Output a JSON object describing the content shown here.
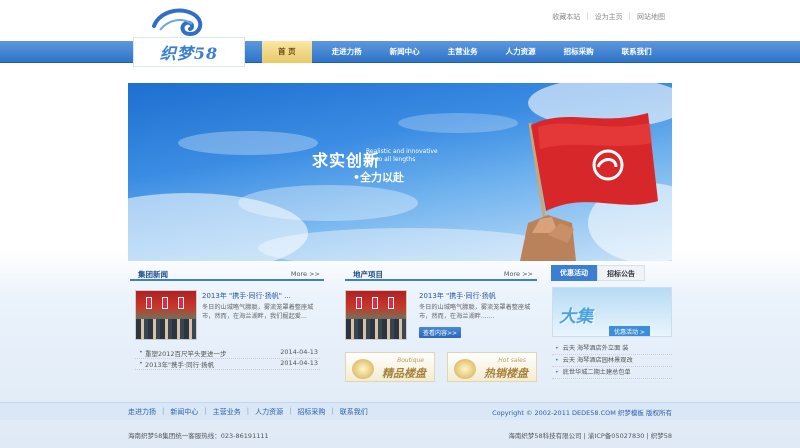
{
  "header": {
    "logo_text": "织梦58",
    "top_links": [
      "收藏本站",
      "设为主页",
      "网站地图"
    ]
  },
  "nav": {
    "items": [
      "首 页",
      "走进力扬",
      "新闻中心",
      "主营业务",
      "人力资源",
      "招标采购",
      "联系我们"
    ]
  },
  "banner": {
    "slogan_part1": "求实",
    "slogan_part2": "创新",
    "slogan_en_line1": "Realistic and innovative",
    "slogan_en_line2": "Go to all lengths",
    "slogan_sub": "•全力以赴"
  },
  "news": {
    "title": "集团新闻",
    "more": "More >>",
    "featured_title": "2013年 \"携手·同行·扬帆\" ...",
    "featured_desc": "冬日的山城略气朦胧，雾流笼罩着整座城市，然而，在海兰湖畔，我们掘起爱...",
    "list": [
      {
        "title": "重塑2012百尺竿头更进一步",
        "date": "2014-04-13"
      },
      {
        "title": "2013年\"携手·同行·扬帆",
        "date": "2014-04-13"
      }
    ]
  },
  "realty": {
    "title": "地产项目",
    "more": "More >>",
    "featured_title": "2013年 \"携手·同行·扬帆",
    "featured_desc": "冬日的山城略气朦胧，雾流笼罩着整座城市，然而，在海兰湖畔.......",
    "more_button": "查看内容>>",
    "promo1_small": "Boutique",
    "promo1_big": "精品楼盘",
    "promo2_small": "Hot sales",
    "promo2_big": "热销楼盘"
  },
  "right": {
    "tab_active": "优惠活动",
    "tab_inactive": "招标公告",
    "banner_big": "大集",
    "banner_btn": "优惠活动 >",
    "list": [
      "云天 海琴酒店外立面 装",
      "云天 海琴酒店园林景观改",
      "底世华城二期土建总包单"
    ]
  },
  "footer": {
    "nav": [
      "走进力扬",
      "新闻中心",
      "主营业务",
      "人力资源",
      "招标采购",
      "联系我们"
    ],
    "copyright": "Copyright © 2002-2011 DEDE58.COM 织梦模板 版权所有",
    "hotline": "海南织梦58集团统一客服热线：023-86191111",
    "icp": "海南织梦58科技有限公司 | 渝ICP备05027830 | 织梦58"
  }
}
